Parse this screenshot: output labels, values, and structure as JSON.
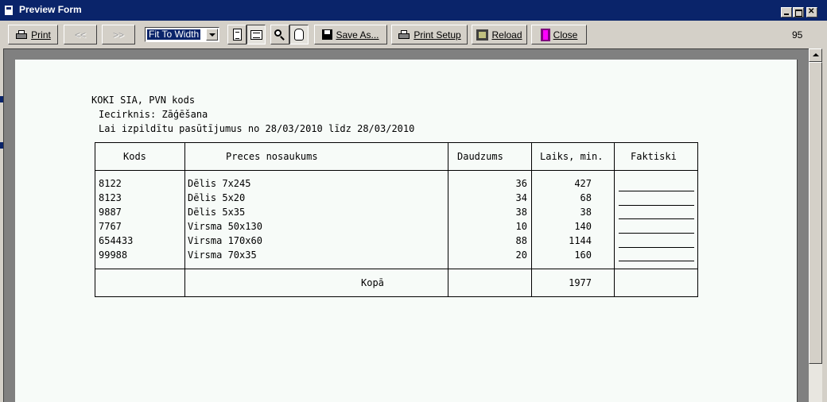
{
  "window": {
    "title": "Preview Form"
  },
  "toolbar": {
    "print": "Print",
    "prev": "<<",
    "next": ">>",
    "zoom_value": "Fit To Width",
    "save_as": "Save As...",
    "print_setup": "Print Setup",
    "reload": "Reload",
    "close": "Close",
    "page_number": "95"
  },
  "report": {
    "company": "KOKI SIA, PVN kods",
    "department": "Iecirknis: Zāģēšana",
    "period": "Lai izpildītu pasūtījumus no 28/03/2010 līdz 28/03/2010",
    "headers": {
      "code": "Kods",
      "name": "Preces nosaukums",
      "qty": "Daudzums",
      "time": "Laiks, min.",
      "actual": "Faktiski"
    },
    "rows": [
      {
        "code": "8122",
        "name": "Dēlis 7x245",
        "qty": "36",
        "time": "427"
      },
      {
        "code": "8123",
        "name": "Dēlis 5x20",
        "qty": "34",
        "time": "68"
      },
      {
        "code": "9887",
        "name": "Dēlis 5x35",
        "qty": "38",
        "time": "38"
      },
      {
        "code": "7767",
        "name": "Virsma 50x130",
        "qty": "10",
        "time": "140"
      },
      {
        "code": "654433",
        "name": "Virsma 170x60",
        "qty": "88",
        "time": "1144"
      },
      {
        "code": "99988",
        "name": "Virsma 70x35",
        "qty": "20",
        "time": "160"
      }
    ],
    "total_label": "Kopā",
    "total_time": "1977"
  }
}
